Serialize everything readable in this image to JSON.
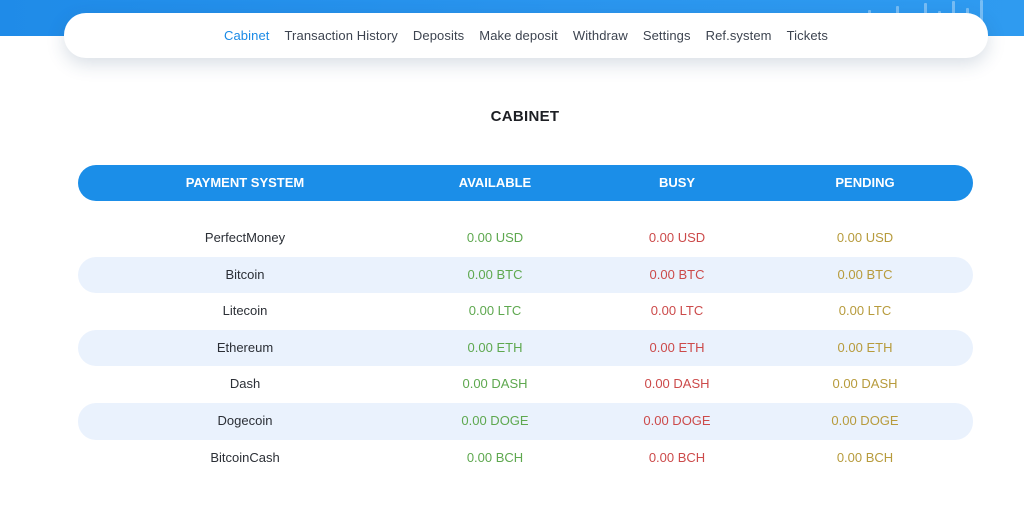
{
  "nav": {
    "items": [
      "Cabinet",
      "Transaction History",
      "Deposits",
      "Make deposit",
      "Withdraw",
      "Settings",
      "Ref.system",
      "Tickets"
    ],
    "active": "Cabinet"
  },
  "page": {
    "title": "CABINET"
  },
  "table": {
    "headers": [
      "PAYMENT SYSTEM",
      "AVAILABLE",
      "BUSY",
      "PENDING"
    ],
    "rows": [
      {
        "system": "PerfectMoney",
        "available": "0.00 USD",
        "busy": "0.00 USD",
        "pending": "0.00 USD"
      },
      {
        "system": "Bitcoin",
        "available": "0.00 BTC",
        "busy": "0.00 BTC",
        "pending": "0.00 BTC"
      },
      {
        "system": "Litecoin",
        "available": "0.00 LTC",
        "busy": "0.00 LTC",
        "pending": "0.00 LTC"
      },
      {
        "system": "Ethereum",
        "available": "0.00 ETH",
        "busy": "0.00 ETH",
        "pending": "0.00 ETH"
      },
      {
        "system": "Dash",
        "available": "0.00 DASH",
        "busy": "0.00 DASH",
        "pending": "0.00 DASH"
      },
      {
        "system": "Dogecoin",
        "available": "0.00 DOGE",
        "busy": "0.00 DOGE",
        "pending": "0.00 DOGE"
      },
      {
        "system": "BitcoinCash",
        "available": "0.00 BCH",
        "busy": "0.00 BCH",
        "pending": "0.00 BCH"
      }
    ]
  },
  "colors": {
    "accent": "#1b8ee8",
    "available": "#5ea84f",
    "busy": "#cc4a4a",
    "pending": "#b79b3c",
    "row_alt": "#eaf2fd"
  }
}
